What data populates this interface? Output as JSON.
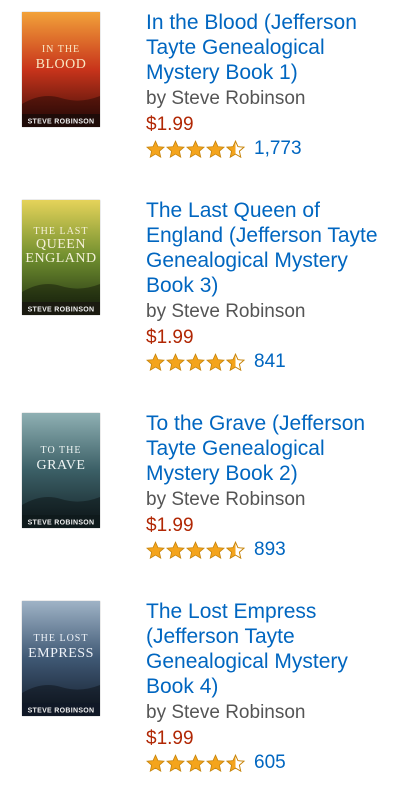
{
  "books": [
    {
      "title": "In the Blood (Jefferson Tayte Genealogical Mystery Book 1)",
      "author": "by Steve Robinson",
      "price": "$1.99",
      "rating": 4.5,
      "review_count": "1,773",
      "cover": {
        "lines": [
          "IN THE",
          "BLOOD"
        ],
        "author_text": "STEVE ROBINSON",
        "colors": {
          "top": "#f2a23a",
          "mid": "#c8341b",
          "bottom": "#3a0c08",
          "text": "#f8e7c4",
          "band": "#1e0b08"
        }
      }
    },
    {
      "title": "The Last Queen of England (Jefferson Tayte Genealogical Mystery Book 3)",
      "author": "by Steve Robinson",
      "price": "$1.99",
      "rating": 4.5,
      "review_count": "841",
      "cover": {
        "lines": [
          "THE LAST",
          "QUEEN",
          "ENGLAND"
        ],
        "author_text": "STEVE ROBINSON",
        "colors": {
          "top": "#e5d35a",
          "mid": "#6f8e2e",
          "bottom": "#1f2e12",
          "text": "#f5f0d8",
          "band": "#1a1a10"
        }
      }
    },
    {
      "title": "To the Grave (Jefferson Tayte Genealogical Mystery Book 2)",
      "author": "by Steve Robinson",
      "price": "$1.99",
      "rating": 4.5,
      "review_count": "893",
      "cover": {
        "lines": [
          "TO THE",
          "GRAVE"
        ],
        "author_text": "STEVE ROBINSON",
        "colors": {
          "top": "#8fb0b3",
          "mid": "#3b5f66",
          "bottom": "#142226",
          "text": "#eef4f3",
          "band": "#0f1a1c"
        }
      }
    },
    {
      "title": "The Lost Empress (Jefferson Tayte Genealogical Mystery Book 4)",
      "author": "by Steve Robinson",
      "price": "$1.99",
      "rating": 4.5,
      "review_count": "605",
      "cover": {
        "lines": [
          "THE LOST",
          "EMPRESS"
        ],
        "author_text": "STEVE ROBINSON",
        "colors": {
          "top": "#9fb3c6",
          "mid": "#3f5874",
          "bottom": "#131c2a",
          "text": "#eef2f8",
          "band": "#101826"
        }
      }
    }
  ],
  "icons": {
    "star_full": "star-full-icon",
    "star_half": "star-half-icon"
  },
  "colors": {
    "link": "#0066c0",
    "price": "#b12704",
    "author": "#555555",
    "star": "#f4a41c"
  }
}
